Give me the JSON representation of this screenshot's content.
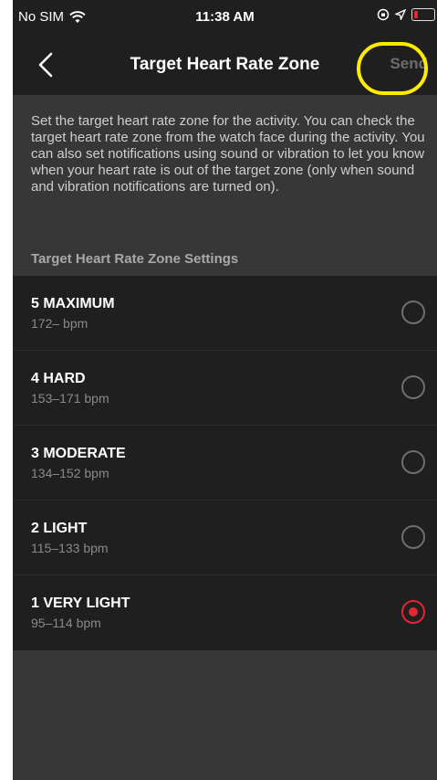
{
  "status_bar": {
    "carrier": "No SIM",
    "time": "11:38 AM"
  },
  "nav": {
    "title": "Target Heart Rate Zone",
    "send_label": "Send"
  },
  "description": "Set the target heart rate zone for the activity. You can check the target heart rate zone from the watch face during the activity. You can also set notifications using sound or vibration to let you know when your heart rate is out of the target zone (only when sound and vibration notifications are turned on).",
  "section_header": "Target Heart Rate Zone Settings",
  "zones": [
    {
      "name": "5 MAXIMUM",
      "bpm": "172– bpm",
      "selected": false
    },
    {
      "name": "4 HARD",
      "bpm": "153–171 bpm",
      "selected": false
    },
    {
      "name": "3 MODERATE",
      "bpm": "134–152 bpm",
      "selected": false
    },
    {
      "name": "2 LIGHT",
      "bpm": "115–133 bpm",
      "selected": false
    },
    {
      "name": "1 VERY LIGHT",
      "bpm": "95–114 bpm",
      "selected": true
    }
  ],
  "colors": {
    "accent": "#e3262f",
    "highlight": "#ffeb00",
    "background": "#373737",
    "panel": "#1f1f1f"
  },
  "icons": [
    "wifi-icon",
    "location-icon",
    "orientation-lock-icon",
    "battery-icon",
    "back-chevron-icon",
    "radio-button"
  ]
}
